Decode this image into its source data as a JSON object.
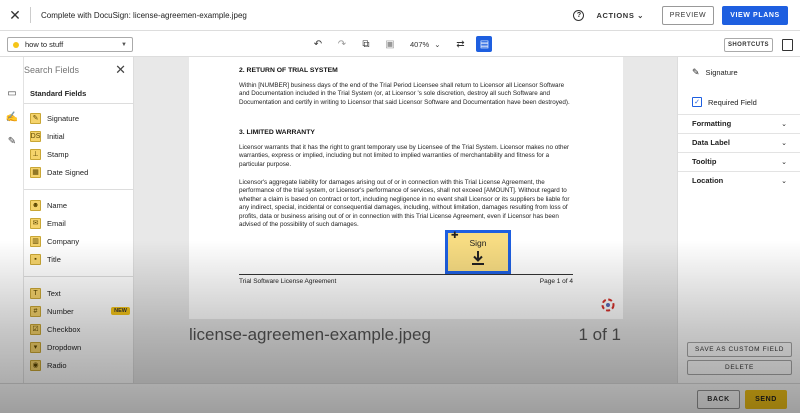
{
  "topbar": {
    "title": "Complete with DocuSign: license-agreemen-example.jpeg",
    "actions_label": "ACTIONS",
    "preview_label": "PREVIEW",
    "view_plans_label": "VIEW PLANS"
  },
  "toolbar": {
    "document_select": "how to stuff",
    "zoom": "407%",
    "shortcuts_label": "SHORTCUTS"
  },
  "fields_panel": {
    "search_placeholder": "Search Fields",
    "section_title": "Standard Fields",
    "group1": [
      {
        "label": "Signature",
        "icon": "pen-icon"
      },
      {
        "label": "Initial",
        "icon": "initial-icon"
      },
      {
        "label": "Stamp",
        "icon": "stamp-icon"
      },
      {
        "label": "Date Signed",
        "icon": "calendar-icon"
      }
    ],
    "group2": [
      {
        "label": "Name",
        "icon": "person-icon"
      },
      {
        "label": "Email",
        "icon": "envelope-icon"
      },
      {
        "label": "Company",
        "icon": "building-icon"
      },
      {
        "label": "Title",
        "icon": "briefcase-icon"
      }
    ],
    "group3": [
      {
        "label": "Text",
        "icon": "text-icon"
      },
      {
        "label": "Number",
        "icon": "hash-icon",
        "badge": "NEW"
      },
      {
        "label": "Checkbox",
        "icon": "checkbox-icon"
      },
      {
        "label": "Dropdown",
        "icon": "dropdown-icon"
      },
      {
        "label": "Radio",
        "icon": "radio-icon"
      }
    ]
  },
  "document": {
    "section2_heading": "2.   RETURN OF TRIAL SYSTEM",
    "section2_text": "Within [NUMBER] business days of the end of the Trial Period Licensee shall return to Licensor all Licensor Software and Documentation included in the Trial System (or, at Licensor 's sole discretion, destroy all such Software and Documentation and certify in writing to Licensor that said Licensor Software and Documentation have been destroyed).",
    "section3_heading": "3.   LIMITED WARRANTY",
    "section3_text1": "Licensor warrants that it has the right to grant temporary use by Licensee of the Trial System. Licensor makes no other warranties, express or implied, including but not limited to implied warranties of merchantability and fitness for a particular purpose.",
    "section3_text2": "Licensor's aggregate liability for damages arising out of or in connection with this Trial License Agreement, the performance of the trial system, or Licensor's performance of services, shall not exceed [AMOUNT]. Without regard to whether a claim is based on contract or tort, including negligence in no event shall Licensor or its suppliers be liable for any indirect, special, incidental or consequential damages, including, without limitation, damages resulting from loss of profits, data or business arising out of or in connection with this Trial License Agreement, even if Licensor has been advised of the possibility of such damages.",
    "footer_left": "Trial Software License Agreement",
    "footer_right": "Page 1 of 4",
    "sign_label": "Sign",
    "filename": "license-agreemen-example.jpeg",
    "page_count": "1 of 1"
  },
  "properties": {
    "field_type": "Signature",
    "required_label": "Required Field",
    "required_checked": true,
    "sections": [
      "Formatting",
      "Data Label",
      "Tooltip",
      "Location"
    ],
    "save_custom_label": "SAVE AS CUSTOM FIELD",
    "delete_label": "DELETE"
  },
  "footer": {
    "back_label": "BACK",
    "send_label": "SEND"
  },
  "colors": {
    "accent_blue": "#1e5fe0",
    "field_yellow": "#f7dc82",
    "send_yellow": "#f5c518"
  }
}
